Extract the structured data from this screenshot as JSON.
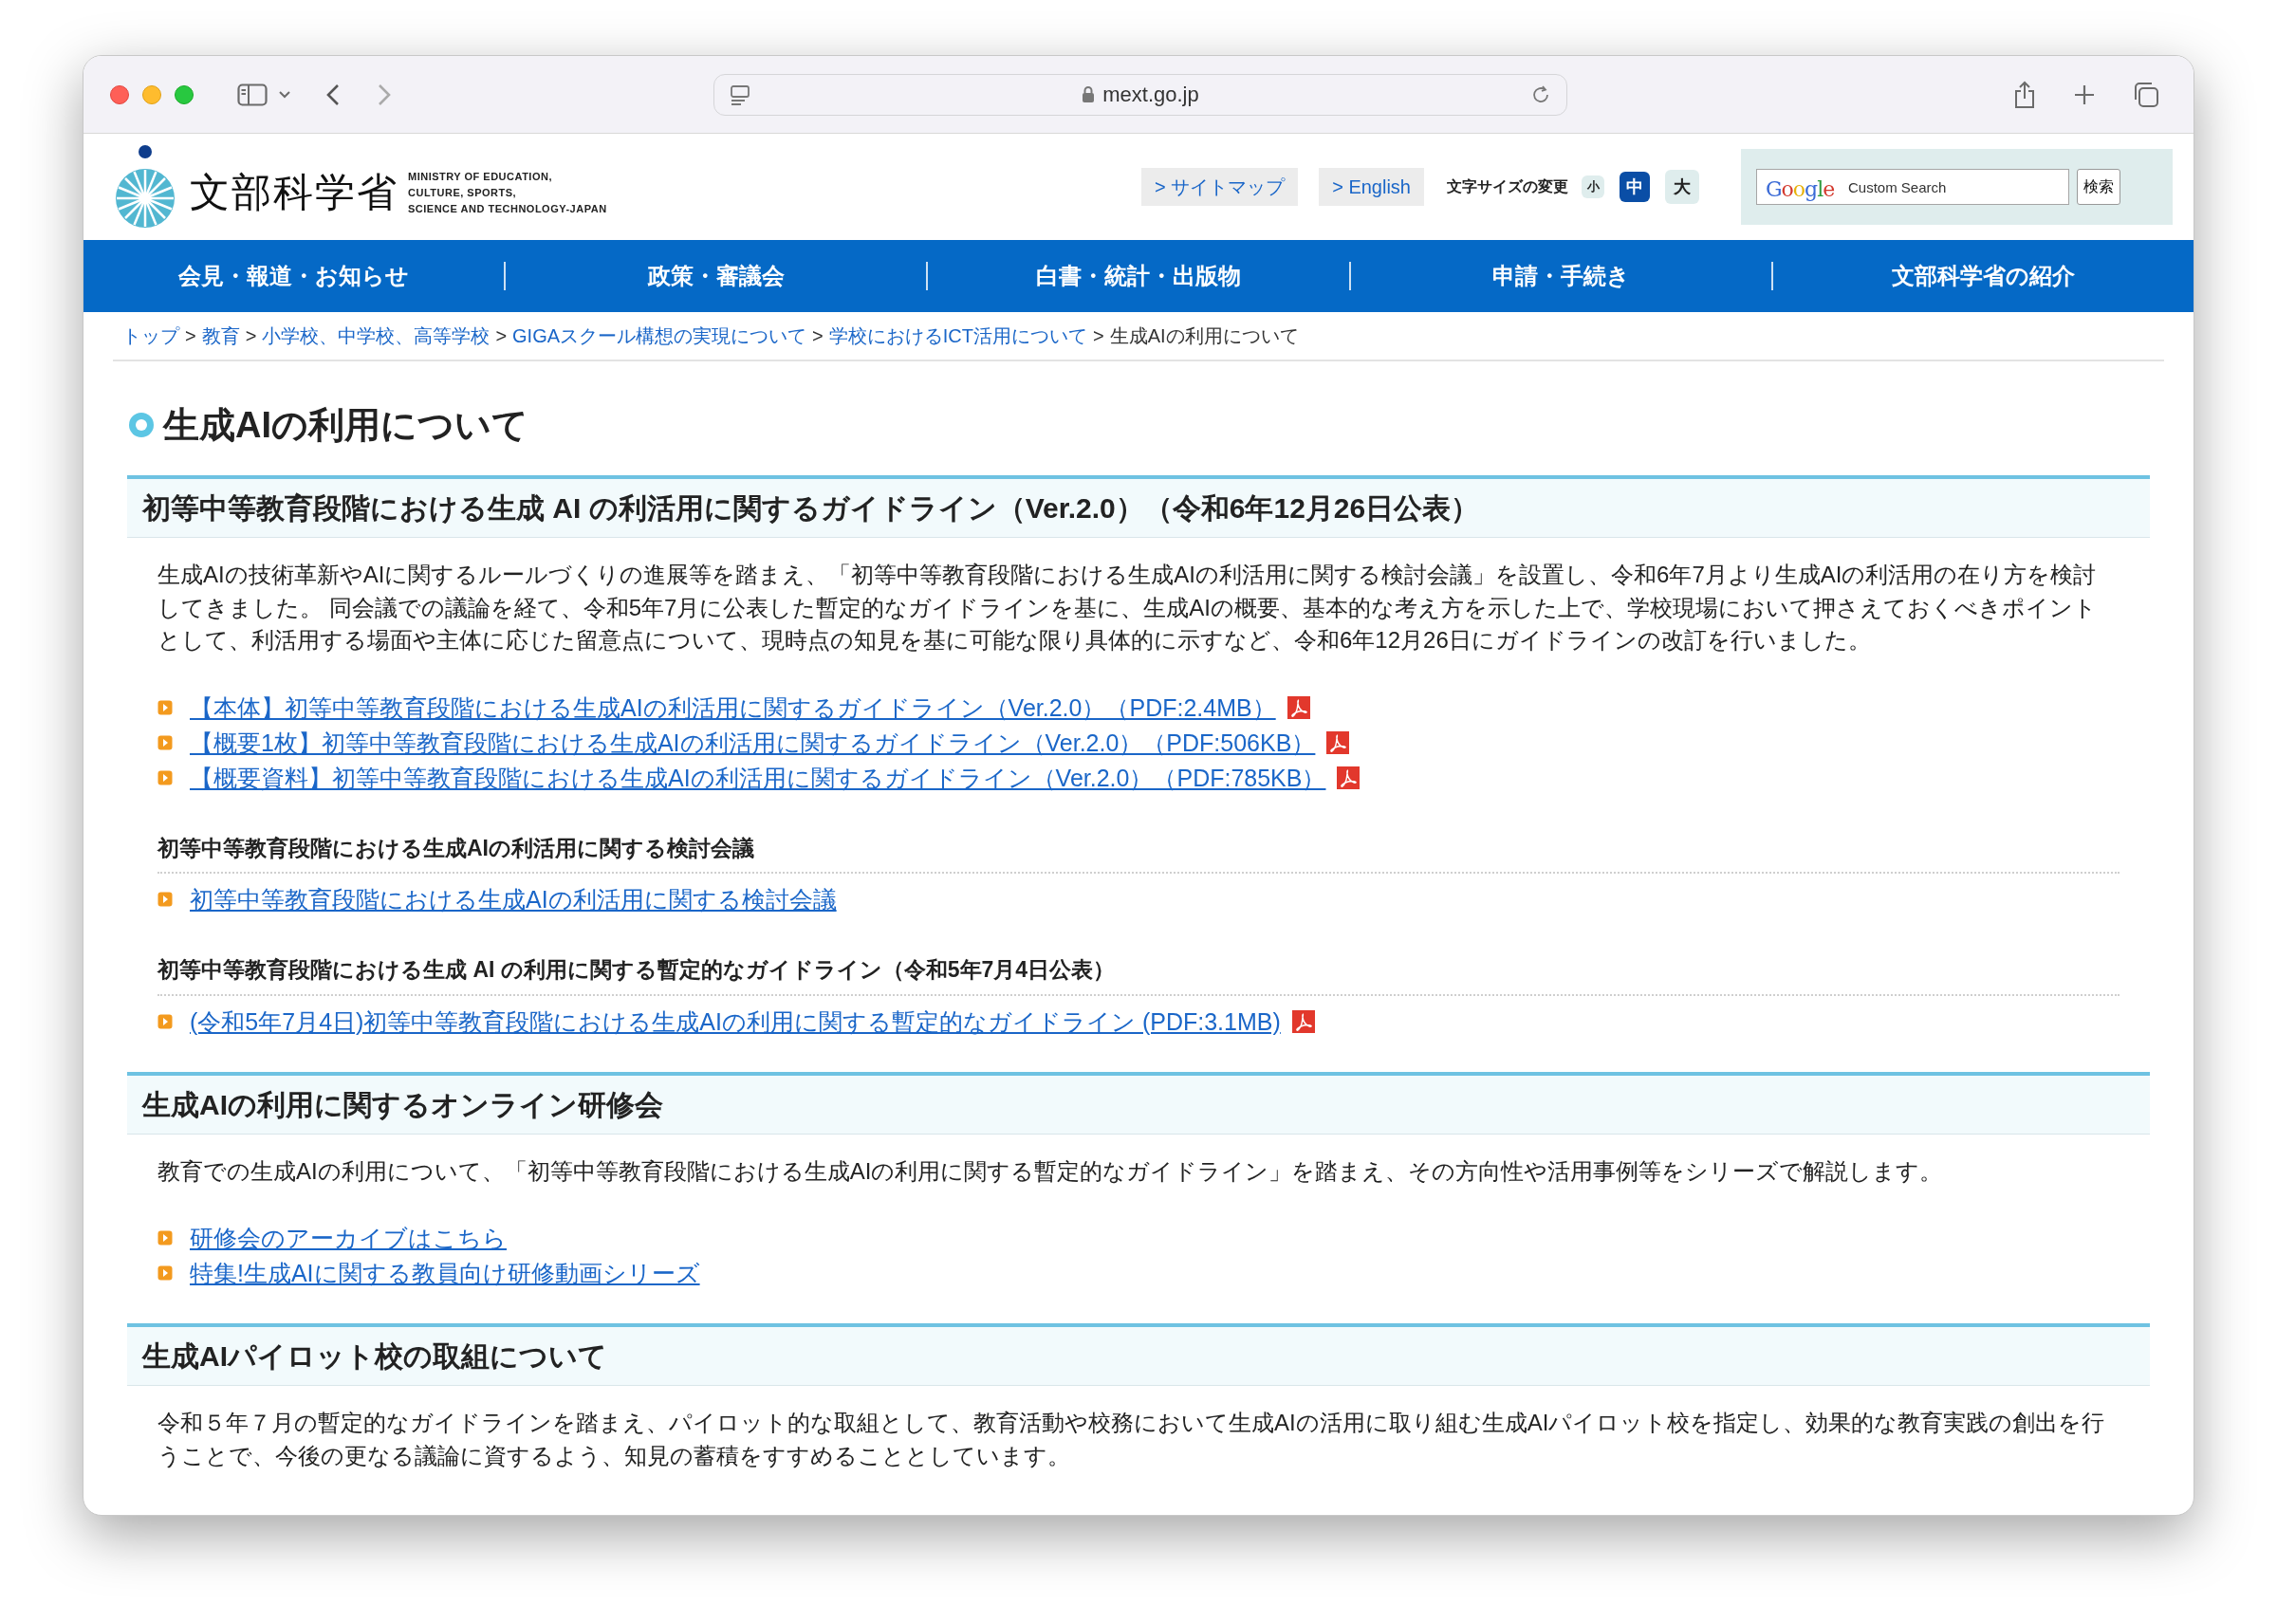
{
  "browser": {
    "url": "mext.go.jp"
  },
  "header": {
    "logo_name": "文部科学省",
    "logo_english": [
      "MINISTRY OF EDUCATION,",
      "CULTURE, SPORTS,",
      "SCIENCE AND TECHNOLOGY-JAPAN"
    ],
    "links": [
      "> サイトマップ",
      "> English"
    ],
    "font_size": {
      "label": "文字サイズの変更",
      "options": [
        {
          "label": "小",
          "selected": false
        },
        {
          "label": "中",
          "selected": true
        },
        {
          "label": "大",
          "selected": false
        }
      ]
    },
    "search": {
      "brand": "Google",
      "placeholder": "Custom Search",
      "button": "検索"
    }
  },
  "nav": [
    "会見・報道・お知らせ",
    "政策・審議会",
    "白書・統計・出版物",
    "申請・手続き",
    "文部科学省の紹介"
  ],
  "breadcrumb": {
    "separator": ">",
    "items": [
      {
        "label": "トップ",
        "link": true
      },
      {
        "label": "教育",
        "link": true
      },
      {
        "label": "小学校、中学校、高等学校",
        "link": true
      },
      {
        "label": "GIGAスクール構想の実現について",
        "link": true
      },
      {
        "label": "学校におけるICT活用について",
        "link": true
      },
      {
        "label": "生成AIの利用について",
        "link": false
      }
    ]
  },
  "page_title": "生成AIの利用について",
  "sections": [
    {
      "heading": "初等中等教育段階における生成 AI の利活用に関するガイドライン（Ver.2.0）（令和6年12月26日公表）",
      "blocks": [
        {
          "kind": "paragraph",
          "text": "生成AIの技術革新やAIに関するルールづくりの進展等を踏まえ、「初等中等教育段階における生成AIの利活用に関する検討会議」を設置し、令和6年7月より生成AIの利活用の在り方を検討してきました。 同会議での議論を経て、令和5年7月に公表した暫定的なガイドラインを基に、生成AIの概要、基本的な考え方を示した上で、学校現場において押さえておくべきポイントとして、利活用する場面や主体に応じた留意点について、現時点の知見を基に可能な限り具体的に示すなど、令和6年12月26日にガイドラインの改訂を行いました。"
        },
        {
          "kind": "links",
          "links": [
            {
              "label": "【本体】初等中等教育段階における生成AIの利活用に関するガイドライン（Ver.2.0）（PDF:2.4MB）",
              "pdf": true
            },
            {
              "label": "【概要1枚】初等中等教育段階における生成AIの利活用に関するガイドライン（Ver.2.0）（PDF:506KB）",
              "pdf": true
            },
            {
              "label": "【概要資料】初等中等教育段階における生成AIの利活用に関するガイドライン（Ver.2.0）（PDF:785KB）",
              "pdf": true
            }
          ]
        },
        {
          "kind": "subheading",
          "text": "初等中等教育段階における生成AIの利活用に関する検討会議"
        },
        {
          "kind": "links",
          "links": [
            {
              "label": "初等中等教育段階における生成AIの利活用に関する検討会議",
              "pdf": false
            }
          ]
        },
        {
          "kind": "subheading",
          "text": "初等中等教育段階における生成 AI の利用に関する暫定的なガイドライン（令和5年7月4日公表）"
        },
        {
          "kind": "links",
          "links": [
            {
              "label": "(令和5年7月4日)初等中等教育段階における生成AIの利用に関する暫定的なガイドライン (PDF:3.1MB)",
              "pdf": true
            }
          ]
        }
      ]
    },
    {
      "heading": "生成AIの利用に関するオンライン研修会",
      "blocks": [
        {
          "kind": "paragraph",
          "text": "教育での生成AIの利用について、「初等中等教育段階における生成AIの利用に関する暫定的なガイドライン」を踏まえ、その方向性や活用事例等をシリーズで解説します。"
        },
        {
          "kind": "links",
          "links": [
            {
              "label": "研修会のアーカイブはこちら",
              "pdf": false
            },
            {
              "label": "特集!生成AIに関する教員向け研修動画シリーズ",
              "pdf": false
            }
          ]
        }
      ]
    },
    {
      "heading": "生成AIパイロット校の取組について",
      "blocks": [
        {
          "kind": "paragraph",
          "text": "令和５年７月の暫定的なガイドラインを踏まえ、パイロット的な取組として、教育活動や校務において生成AIの活用に取り組む生成AIパイロット校を指定し、効果的な教育実践の創出を行うことで、今後の更なる議論に資するよう、知見の蓄積をすすめることとしています。"
        }
      ]
    }
  ]
}
